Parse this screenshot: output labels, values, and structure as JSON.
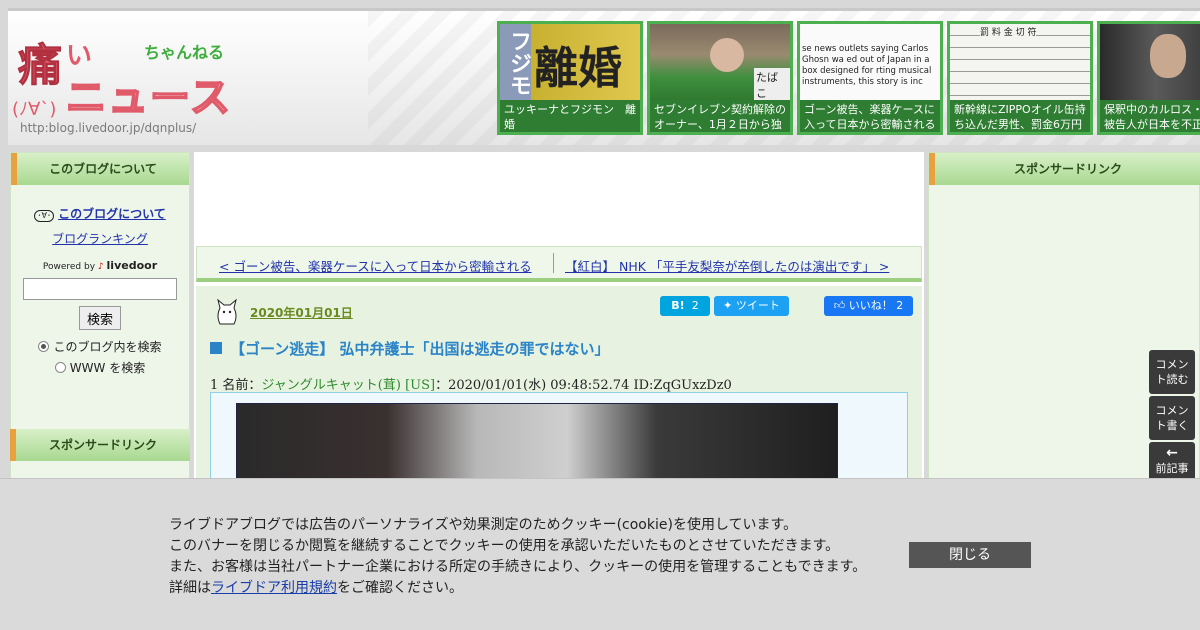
{
  "header": {
    "logo": {
      "kanji": "痛",
      "ii": "い",
      "chan": "ちゃんねる",
      "news": "ニュース",
      "face": "(ﾉ∀`)",
      "url": "http:blog.livedoor.jp/dqnplus/"
    },
    "thumbs": [
      {
        "caption": "ユッキーナとフジモン　離婚",
        "overlay": "離婚",
        "overlay_left": "フジモ"
      },
      {
        "caption": "セブンイレブン契約解除のオーナー、1月２日から独",
        "overlay": "たばこ"
      },
      {
        "caption": "ゴーン被告、楽器ケースに入って日本から密輸される",
        "overlay": "se news outlets saying Carlos Ghosn wa ed out of Japan in a box designed for rting musical instruments, this story is inc"
      },
      {
        "caption": "新幹線にZIPPOオイル缶持ち込んだ男性、罰金6万円",
        "overlay": "罰 料 金 切 符"
      },
      {
        "caption": "保釈中のカルロス・ゴーン被告人が日本を不正",
        "overlay": ""
      }
    ]
  },
  "left_sidebar": {
    "heading": "このブログについて",
    "about_link": "このブログについて",
    "ranking_link": "ブログランキング",
    "powered_by": "Powered by",
    "powered_brand": "livedoor",
    "search_button": "検索",
    "search_placeholder": "",
    "radio_blog": "このブログ内を検索",
    "radio_www": "WWW を検索",
    "sponsor_heading": "スポンサードリンク"
  },
  "nav": {
    "prev": "< ゴーン被告、楽器ケースに入って日本から密輸される",
    "next": "【紅白】 NHK 「平手友梨奈が卒倒したのは演出です」 >"
  },
  "post": {
    "date": "2020年01月01日",
    "hatena_label": "B!",
    "hatena_count": "2",
    "tweet_label": "ツイート",
    "like_label": "いいね！",
    "like_count": "2",
    "title": "【ゴーン逃走】 弘中弁護士「出国は逃走の罪ではない」",
    "res_number": "1",
    "res_label": "名前：",
    "res_name": "ジャングルキャット(茸) [US]",
    "res_meta": "：2020/01/01(水) 09:48:52.74 ID:ZqGUxzDz0"
  },
  "right_sidebar": {
    "heading": "スポンサードリンク"
  },
  "float_buttons": {
    "read_comments": "コメント読む",
    "write_comment": "コメント書く",
    "prev_article": "前記事"
  },
  "cookie": {
    "line1": "ライブドアブログでは広告のパーソナライズや効果測定のためクッキー(cookie)を使用しています。",
    "line2": "このバナーを閉じるか閲覧を継続することでクッキーの使用を承認いただいたものとさせていただきます。",
    "line3": "また、お客様は当社パートナー企業における所定の手続きにより、クッキーの使用を管理することもできます。",
    "line4_prefix": "詳細は",
    "line4_link": "ライブドア利用規約",
    "line4_suffix": "をご確認ください。",
    "close_label": "閉じる"
  },
  "colors": {
    "accent_green": "#4caf50",
    "caption_green": "#2e7d32",
    "title_blue": "#2b83c8",
    "hatena": "#00a4de",
    "twitter": "#1da1f2",
    "facebook": "#1877f2"
  }
}
